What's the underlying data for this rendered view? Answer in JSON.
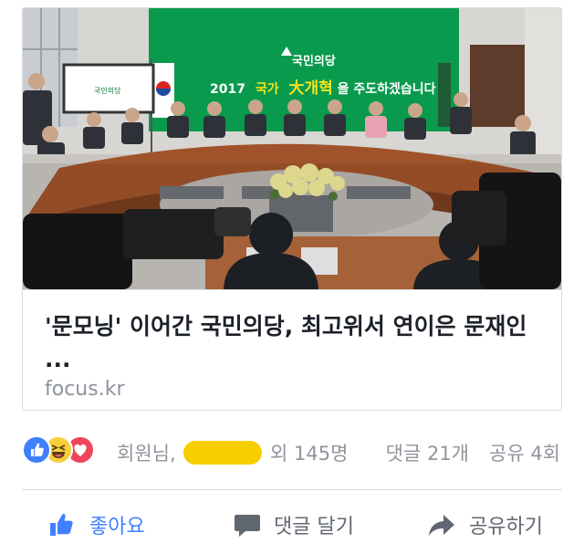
{
  "link_preview": {
    "image_alt": "photo",
    "photo_texts": {
      "party_logo": "국민의당",
      "banner_year": "2017",
      "banner_part1": "국가",
      "banner_big": "大개혁",
      "banner_part2": "을 주도하겠습니다",
      "monitor_logo": "국민의당"
    },
    "headline": "'문모닝' 이어간 국민의당, 최고위서 연이은 문재인",
    "ellipsis": "...",
    "domain": "focus.kr"
  },
  "reactions": {
    "icons": [
      "like-icon",
      "haha-icon",
      "love-icon"
    ],
    "names_prefix": "회원님,",
    "names_suffix": "외 145명",
    "comments": "댓글 21개",
    "shares": "공유 4회"
  },
  "actions": {
    "like": "좋아요",
    "comment": "댓글 달기",
    "share": "공유하기"
  },
  "colors": {
    "accent": "#4080ff",
    "banner_green": "#0a9a4e",
    "redaction": "#f7cf00"
  }
}
